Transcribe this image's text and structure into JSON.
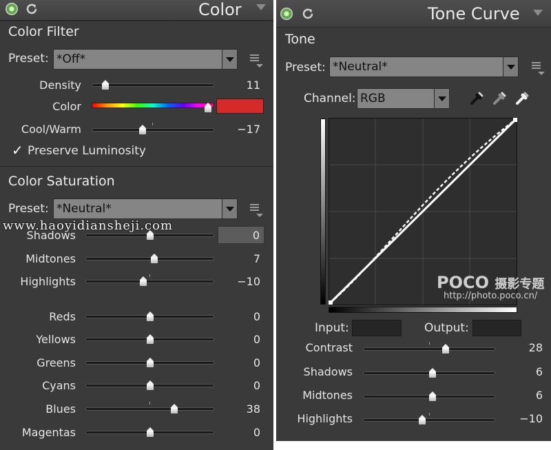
{
  "color_panel": {
    "title": "Color",
    "color_filter": {
      "title": "Color Filter",
      "preset_label": "Preset:",
      "preset_value": "*Off*",
      "sliders": [
        {
          "label": "Density",
          "value": "11",
          "level": 0.11
        },
        {
          "label": "Cool/Warm",
          "value": "−17",
          "level": 0.415
        }
      ],
      "color_label": "Color",
      "hue_level": 0.95,
      "swatch_color": "#d42a2a",
      "preserve_luminosity": {
        "checked": true,
        "mark": "✓",
        "label": "Preserve Luminosity"
      }
    },
    "color_saturation": {
      "title": "Color Saturation",
      "preset_label": "Preset:",
      "preset_value": "*Neutral*",
      "tone_sliders": [
        {
          "label": "Shadows",
          "value": "0",
          "level": 0.5
        },
        {
          "label": "Midtones",
          "value": "7",
          "level": 0.535
        },
        {
          "label": "Highlights",
          "value": "−10",
          "level": 0.45
        }
      ],
      "color_sliders": [
        {
          "label": "Reds",
          "value": "0",
          "level": 0.5
        },
        {
          "label": "Yellows",
          "value": "0",
          "level": 0.5
        },
        {
          "label": "Greens",
          "value": "0",
          "level": 0.5
        },
        {
          "label": "Cyans",
          "value": "0",
          "level": 0.5
        },
        {
          "label": "Blues",
          "value": "38",
          "level": 0.69
        },
        {
          "label": "Magentas",
          "value": "0",
          "level": 0.5
        }
      ]
    }
  },
  "tone_curve_panel": {
    "title": "Tone Curve",
    "tone_title": "Tone",
    "preset_label": "Preset:",
    "preset_value": "*Neutral*",
    "channel_label": "Channel:",
    "channel_value": "RGB",
    "input_label": "Input:",
    "output_label": "Output:",
    "sliders": [
      {
        "label": "Contrast",
        "value": "28",
        "level": 0.625
      },
      {
        "label": "Shadows",
        "value": "6",
        "level": 0.525
      },
      {
        "label": "Midtones",
        "value": "6",
        "level": 0.525
      },
      {
        "label": "Highlights",
        "value": "−10",
        "level": 0.45
      }
    ]
  },
  "watermark": {
    "text": "www.haoyidiansheji.com"
  },
  "logo": {
    "brand": "POCO",
    "brand_cn": "摄影专题",
    "url": "http://photo.poco.cn/"
  }
}
